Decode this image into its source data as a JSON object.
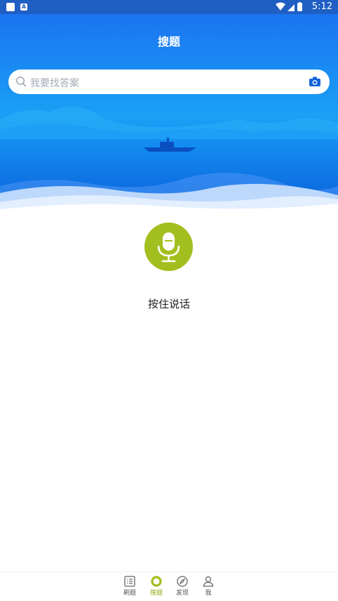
{
  "status_bar": {
    "time": "5:12",
    "icons": [
      "square-icon",
      "a-notification-icon",
      "wifi-icon",
      "signal-icon",
      "battery-icon"
    ],
    "notification_letter": "A"
  },
  "header": {
    "title": "搜题",
    "background_color": "#1a73e8"
  },
  "search": {
    "placeholder": "我要找答案",
    "icons": [
      "search-icon",
      "camera-icon"
    ]
  },
  "voice": {
    "label": "按住说话",
    "button_color": "#a3bf1f",
    "icon": "microphone-icon"
  },
  "bottom_nav": {
    "active_index": 1,
    "accent_color": "#8fae14",
    "items": [
      {
        "label": "刷题",
        "icon": "list-icon"
      },
      {
        "label": "搜题",
        "icon": "search-ring-icon"
      },
      {
        "label": "发现",
        "icon": "compass-icon"
      },
      {
        "label": "我",
        "icon": "user-icon"
      }
    ]
  }
}
